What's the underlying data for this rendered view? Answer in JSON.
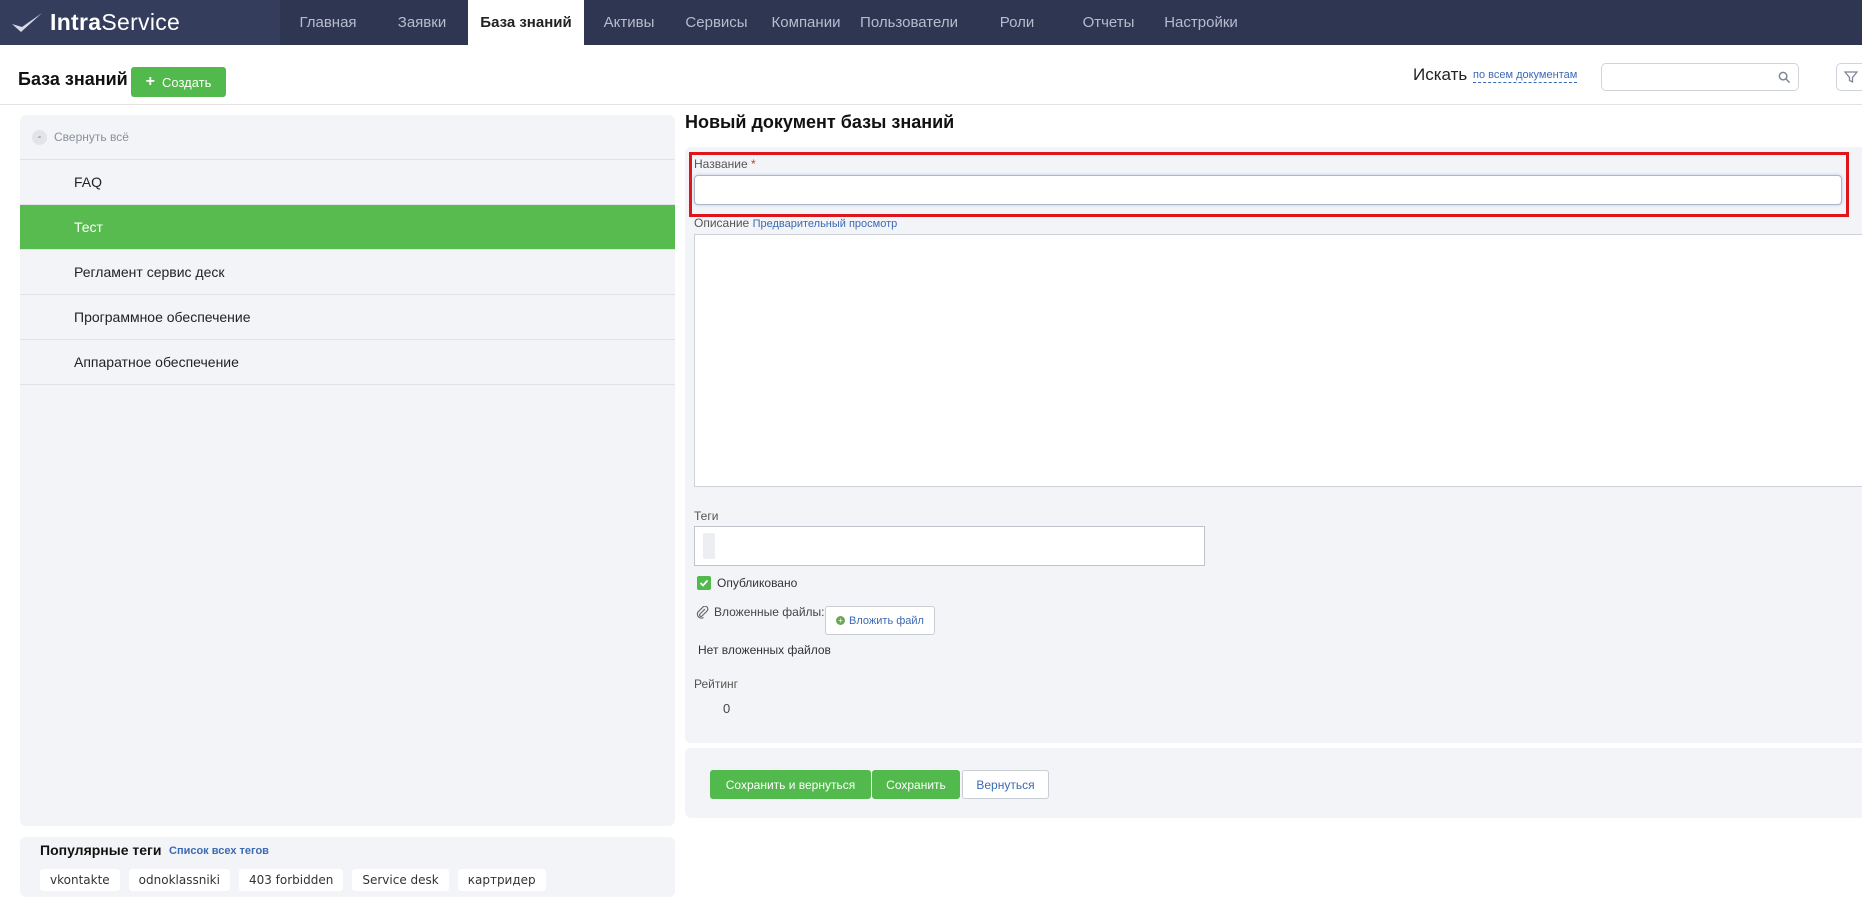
{
  "app": {
    "logo_intra": "Intra",
    "logo_service": "Service"
  },
  "nav": {
    "items": [
      {
        "label": "Главная"
      },
      {
        "label": "Заявки"
      },
      {
        "label": "База знаний",
        "active": true
      },
      {
        "label": "Активы"
      },
      {
        "label": "Сервисы"
      },
      {
        "label": "Компании"
      },
      {
        "label": "Пользователи"
      },
      {
        "label": "Роли"
      },
      {
        "label": "Отчеты"
      },
      {
        "label": "Настройки"
      }
    ]
  },
  "header": {
    "title": "База знаний",
    "create_label": "Создать",
    "search_label": "Искать",
    "search_scope": "по всем документам",
    "search_value": ""
  },
  "tree": {
    "collapse_label": "Свернуть всё",
    "collapse_symbol": "-",
    "items": [
      {
        "label": "FAQ"
      },
      {
        "label": "Тест",
        "active": true
      },
      {
        "label": "Регламент сервис деск"
      },
      {
        "label": "Программное обеспечение"
      },
      {
        "label": "Аппаратное обеспечение"
      }
    ]
  },
  "popular_tags": {
    "title": "Популярные теги",
    "all_link": "Список всех тегов",
    "tags": [
      "vkontakte",
      "odnoklassniki",
      "403 forbidden",
      "Service desk",
      "картридер"
    ]
  },
  "form": {
    "title": "Новый документ базы знаний",
    "name_label": "Название",
    "required_mark": "*",
    "name_value": "",
    "description_label": "Описание",
    "preview_link": "Предварительный просмотр",
    "description_value": "",
    "tags_label": "Теги",
    "published_label": "Опубликовано",
    "published_checked": true,
    "attachments_label": "Вложенные файлы:",
    "attach_button": "Вложить файл",
    "no_files": "Нет вложенных файлов",
    "rating_label": "Рейтинг",
    "rating_value": "0"
  },
  "actions": {
    "save_and_return": "Сохранить и вернуться",
    "save": "Сохранить",
    "back": "Вернуться"
  },
  "colors": {
    "nav_bg": "#2f3651",
    "accent_green": "#52b94c",
    "link_blue": "#3b6ab4",
    "highlight_red": "#e0151b"
  }
}
